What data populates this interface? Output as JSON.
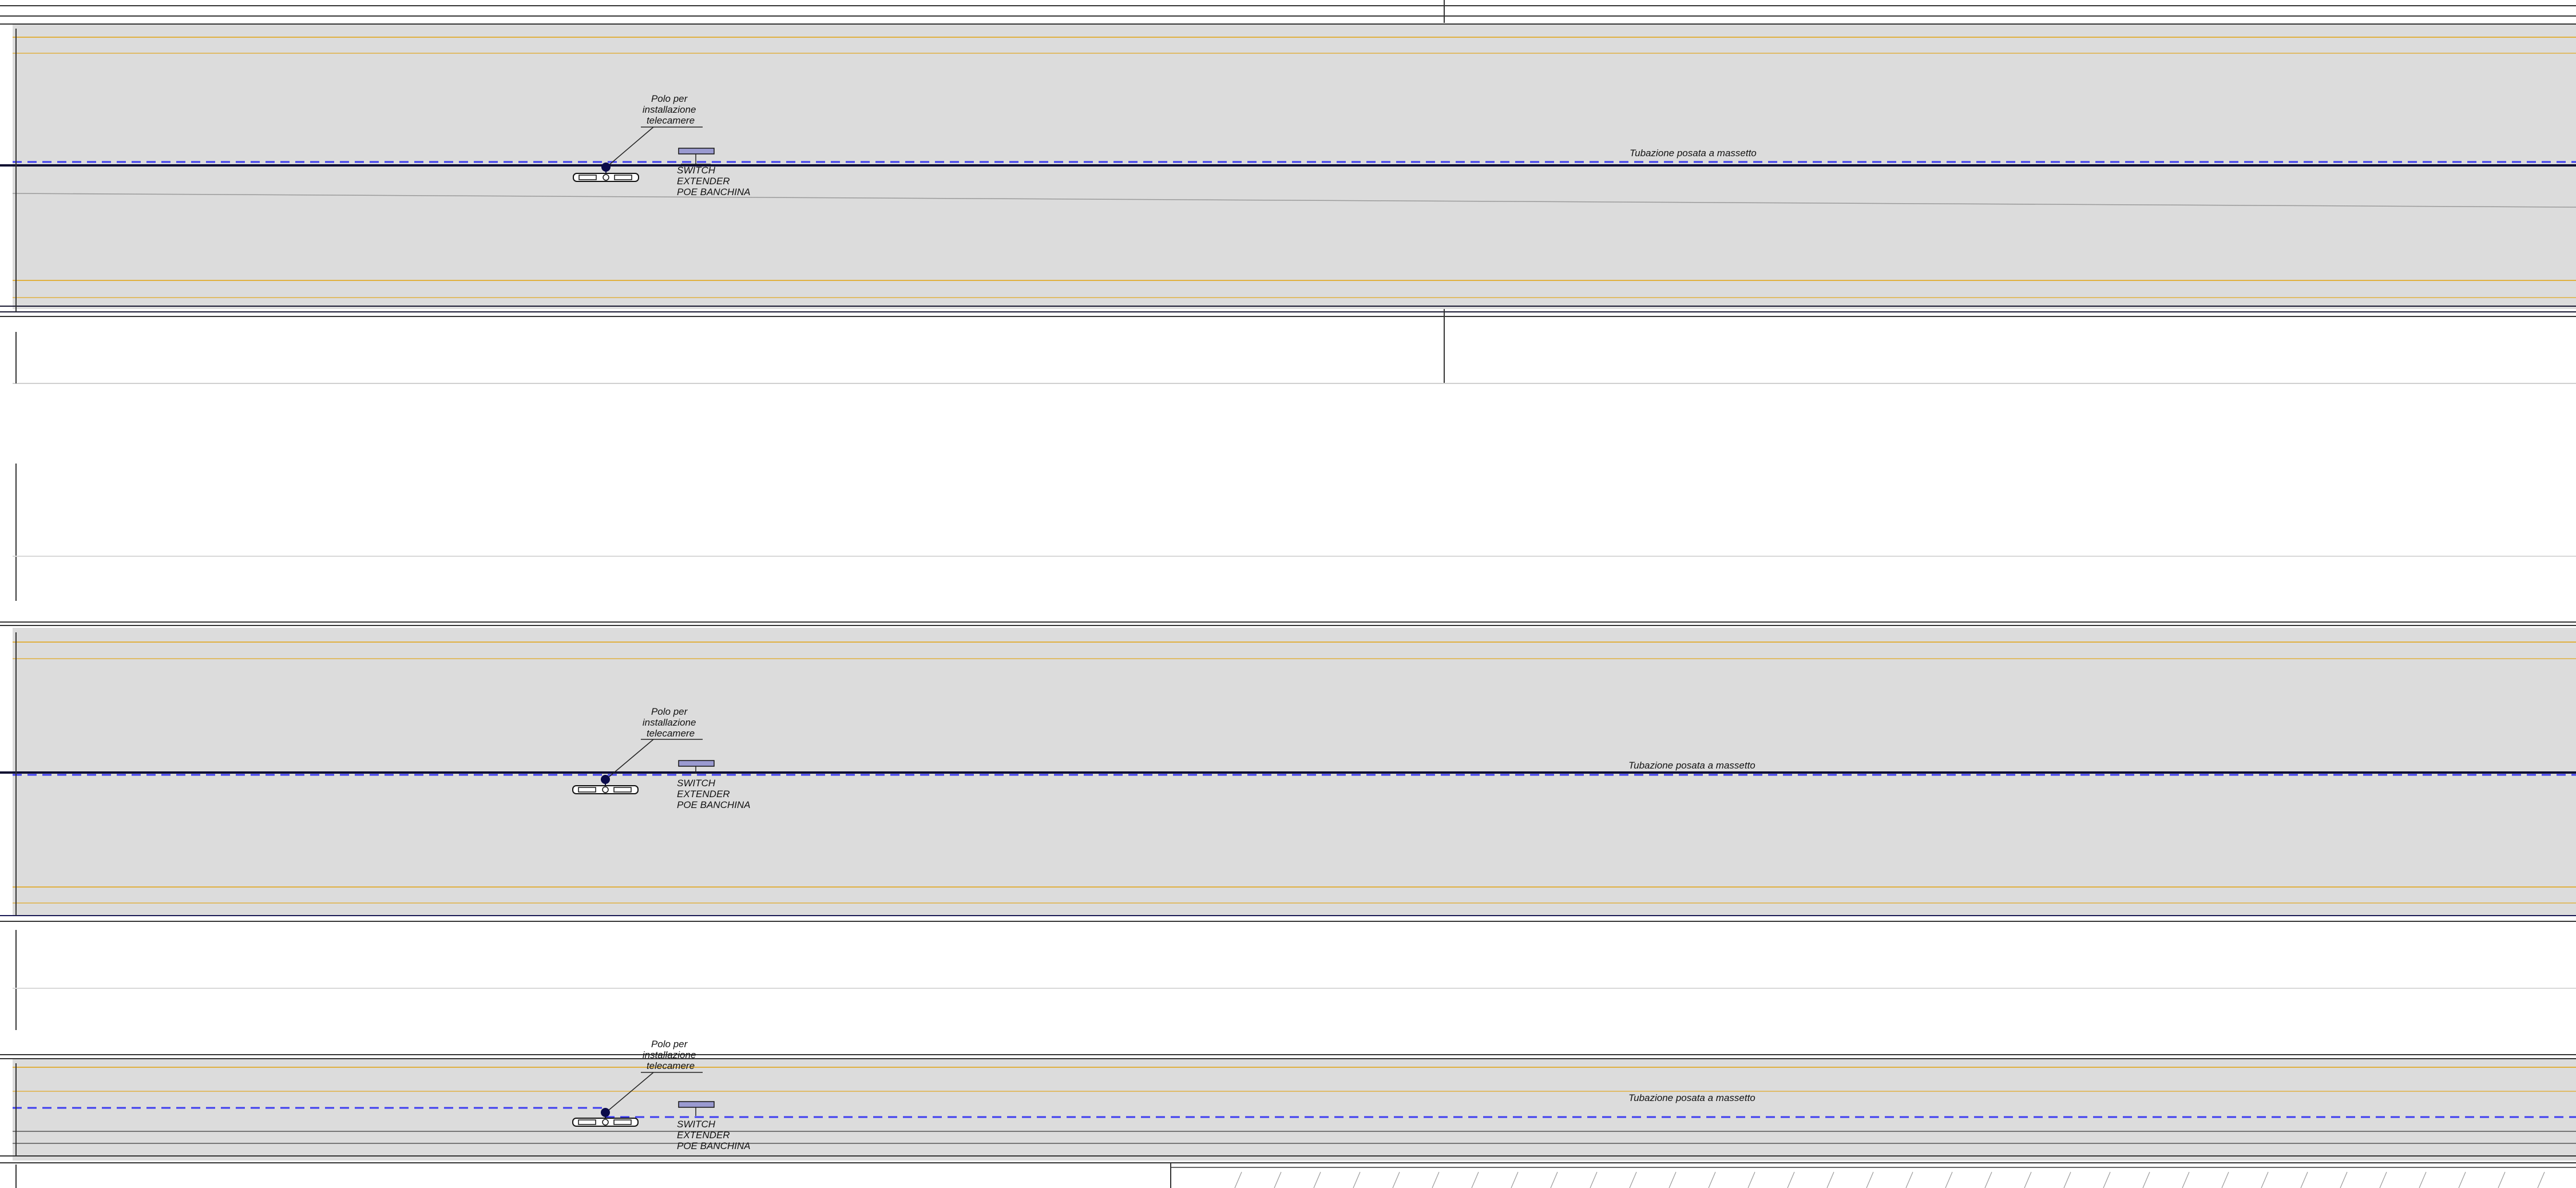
{
  "drawing": {
    "colors": {
      "background": "#ffffff",
      "platform_fill": "#dcdcdc",
      "platform_edge": "#1a1a33",
      "tactile_line": "#e0b040",
      "pipe_line": "#3d3df0",
      "camera_pole": "#0b0b4a",
      "frame": "#333333"
    },
    "sections": [
      {
        "id": "platform-1",
        "pole_label": [
          "Polo per",
          "installazione",
          "telecamere"
        ],
        "switch_label": [
          "SWITCH",
          "EXTENDER",
          "POE BANCHINA"
        ],
        "pipe_label": "Tubazione posata a massetto"
      },
      {
        "id": "platform-2",
        "pole_label": [
          "Polo per",
          "installazione",
          "telecamere"
        ],
        "switch_label": [
          "SWITCH",
          "EXTENDER",
          "POE BANCHINA"
        ],
        "pipe_label": "Tubazione posata a massetto"
      },
      {
        "id": "platform-3",
        "pole_label": [
          "Polo per",
          "installazione",
          "telecamere"
        ],
        "switch_label": [
          "SWITCH",
          "EXTENDER",
          "POE BANCHINA"
        ],
        "pipe_label": "Tubazione posata a massetto"
      }
    ]
  }
}
